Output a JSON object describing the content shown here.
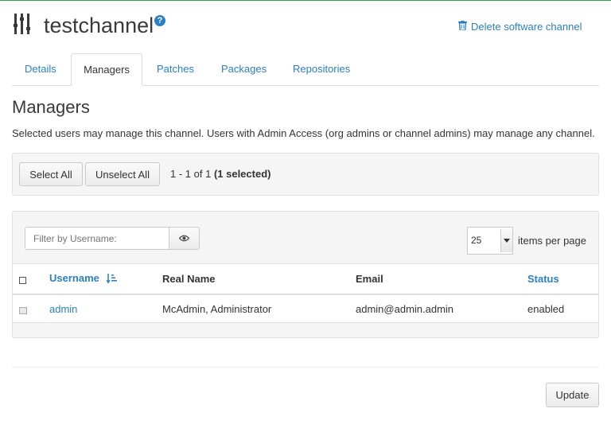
{
  "header": {
    "title": "testchannel",
    "help_glyph": "?",
    "delete_label": "Delete software channel"
  },
  "tabs": [
    {
      "label": "Details",
      "active": false
    },
    {
      "label": "Managers",
      "active": true
    },
    {
      "label": "Patches",
      "active": false
    },
    {
      "label": "Packages",
      "active": false
    },
    {
      "label": "Repositories",
      "active": false
    }
  ],
  "section": {
    "title": "Managers",
    "description": "Selected users may manage this channel. Users with Admin Access (org admins or channel admins) may manage any channel."
  },
  "selection": {
    "select_all_label": "Select All",
    "unselect_all_label": "Unselect All",
    "range_text": "1 - 1 of 1",
    "selected_text": "(1 selected)"
  },
  "list": {
    "filter_placeholder": "Filter by Username:",
    "per_page_value": "25",
    "per_page_label": "items per page",
    "columns": {
      "username": "Username",
      "real_name": "Real Name",
      "email": "Email",
      "status": "Status"
    },
    "rows": [
      {
        "username": "admin",
        "real_name": "McAdmin, Administrator",
        "email": "admin@admin.admin",
        "status": "enabled"
      }
    ]
  },
  "footer": {
    "update_label": "Update"
  },
  "colors": {
    "accent": "#2b7fc4",
    "top_bar": "#2fa04b"
  },
  "icons": [
    "channel-icon",
    "help-icon",
    "trash-icon",
    "eye-icon",
    "sort-alpha-icon",
    "select-all-checkbox-icon",
    "row-checkbox-icon"
  ]
}
